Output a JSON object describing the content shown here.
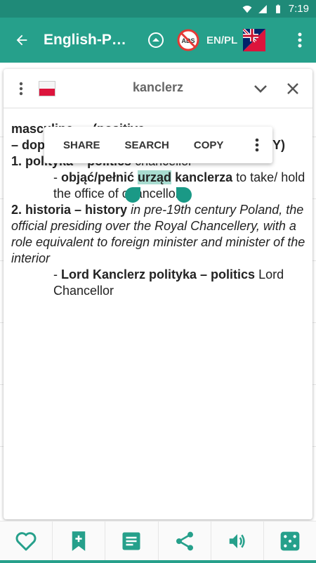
{
  "status_bar": {
    "time": "7:19"
  },
  "app_bar": {
    "title": "English-P…",
    "language_pair": "EN/PL"
  },
  "entry": {
    "word": "kanclerz",
    "line1": "masculine … (positive",
    "line2_a": "– dop",
    "line2_b": "RZY)",
    "sense1_number": "1.",
    "sense1_domain": "polityka – politics",
    "sense1_gloss": "chancellor",
    "example1_dash": "- ",
    "example1_pl_a": "objąć/pełnić",
    "example1_pl_sel": "urząd",
    "example1_pl_b": "kanclerza",
    "example1_en": "to take/ hold the office of chancellor",
    "sense2_number": "2.",
    "sense2_domain": "historia – history",
    "sense2_desc": "in pre-19th century Poland, the official presiding over the Royal Chancellery, with a role equivalent to foreign minister and minister of the interior",
    "example2_dash": "- ",
    "example2_pl": "Lord Kanclerz polityka – politics",
    "example2_en": "Lord Chancellor"
  },
  "text_toolbar": {
    "share": "SHARE",
    "search": "SEARCH",
    "copy": "COPY"
  },
  "colors": {
    "primary": "#26a08b",
    "primary_dark": "#1f8a78",
    "selection": "#a8dcd0",
    "handle": "#1a9986"
  },
  "bottom_bar": {
    "icons": [
      "heart-icon",
      "bookmark-add-icon",
      "note-icon",
      "share-icon",
      "speaker-icon",
      "dice-icon"
    ]
  }
}
